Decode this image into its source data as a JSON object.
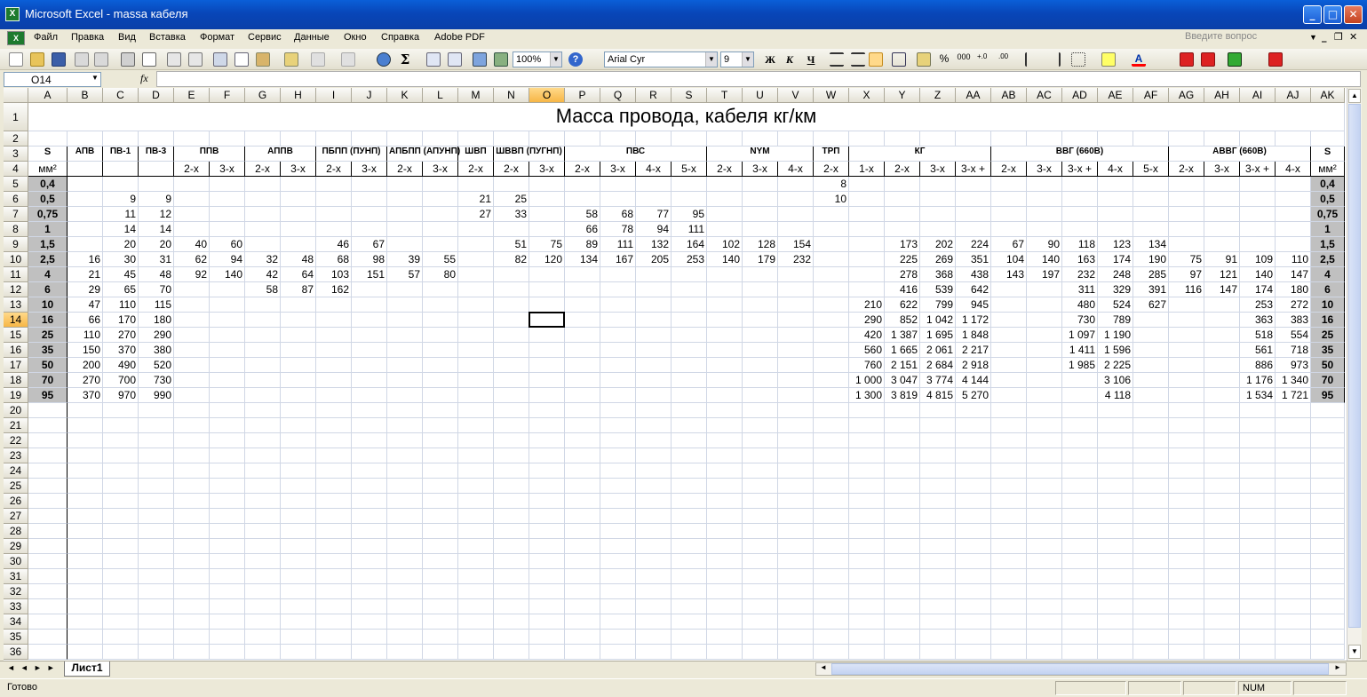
{
  "window": {
    "title": "Microsoft Excel - massa кабеля"
  },
  "menu": [
    "Файл",
    "Правка",
    "Вид",
    "Вставка",
    "Формат",
    "Сервис",
    "Данные",
    "Окно",
    "Справка",
    "Adobe PDF"
  ],
  "ask_placeholder": "Введите вопрос",
  "toolbar": {
    "zoom": "100%",
    "font": "Arial Cyr",
    "size": "9",
    "bold": "Ж",
    "italic": "К",
    "underline": "Ч",
    "percent": "%",
    "thousands": "000"
  },
  "formula": {
    "name_box": "O14",
    "fx": "fx",
    "value": ""
  },
  "columns": [
    "A",
    "B",
    "C",
    "D",
    "E",
    "F",
    "G",
    "H",
    "I",
    "J",
    "K",
    "L",
    "M",
    "N",
    "O",
    "P",
    "Q",
    "R",
    "S",
    "T",
    "U",
    "V",
    "W",
    "X",
    "Y",
    "Z",
    "AA",
    "AB",
    "AC",
    "AD",
    "AE",
    "AF",
    "AG",
    "AH",
    "AI",
    "AJ",
    "AK"
  ],
  "selected_col": "O",
  "selected_row": 14,
  "rows_count": 36,
  "sheet": {
    "title": "Масса провода, кабеля кг/км",
    "header3": [
      {
        "c": 0,
        "span": 1,
        "t": "S"
      },
      {
        "c": 1,
        "span": 1,
        "t": "АПВ"
      },
      {
        "c": 2,
        "span": 1,
        "t": "ПВ-1"
      },
      {
        "c": 3,
        "span": 1,
        "t": "ПВ-3"
      },
      {
        "c": 4,
        "span": 2,
        "t": "ППВ"
      },
      {
        "c": 6,
        "span": 2,
        "t": "АППВ"
      },
      {
        "c": 8,
        "span": 2,
        "t": "ПБПП (ПУНП)"
      },
      {
        "c": 10,
        "span": 2,
        "t": "АПБПП (АПУНП)"
      },
      {
        "c": 12,
        "span": 1,
        "t": "ШВП"
      },
      {
        "c": 13,
        "span": 2,
        "t": "ШВВП (ПУГНП)"
      },
      {
        "c": 15,
        "span": 4,
        "t": "ПВС"
      },
      {
        "c": 19,
        "span": 3,
        "t": "NYM"
      },
      {
        "c": 22,
        "span": 1,
        "t": "ТРП"
      },
      {
        "c": 23,
        "span": 4,
        "t": "КГ"
      },
      {
        "c": 27,
        "span": 5,
        "t": "ВВГ (660В)"
      },
      {
        "c": 32,
        "span": 4,
        "t": "АВВГ (660В)"
      },
      {
        "c": 36,
        "span": 1,
        "t": "S"
      }
    ],
    "header4": {
      "0": "мм²",
      "4": "2-х",
      "5": "3-х",
      "6": "2-х",
      "7": "3-х",
      "8": "2-х",
      "9": "3-х",
      "10": "2-х",
      "11": "3-х",
      "12": "2-х",
      "13": "2-х",
      "14": "3-х",
      "15": "2-х",
      "16": "3-х",
      "17": "4-х",
      "18": "5-х",
      "19": "2-х",
      "20": "3-х",
      "21": "4-х",
      "22": "2-х",
      "23": "1-х",
      "24": "2-х",
      "25": "3-х",
      "26": "3-х +",
      "27": "2-х",
      "28": "3-х",
      "29": "3-х +",
      "30": "4-х",
      "31": "5-х",
      "32": "2-х",
      "33": "3-х",
      "34": "3-х +",
      "35": "4-х",
      "36": "мм²"
    },
    "data": [
      {
        "s": "0,4",
        "v": {
          "22": "8"
        }
      },
      {
        "s": "0,5",
        "v": {
          "2": "9",
          "3": "9",
          "12": "21",
          "13": "25",
          "22": "10"
        }
      },
      {
        "s": "0,75",
        "v": {
          "2": "11",
          "3": "12",
          "12": "27",
          "13": "33",
          "15": "58",
          "16": "68",
          "17": "77",
          "18": "95"
        }
      },
      {
        "s": "1",
        "v": {
          "2": "14",
          "3": "14",
          "15": "66",
          "16": "78",
          "17": "94",
          "18": "111"
        }
      },
      {
        "s": "1,5",
        "v": {
          "2": "20",
          "3": "20",
          "4": "40",
          "5": "60",
          "8": "46",
          "9": "67",
          "13": "51",
          "14": "75",
          "15": "89",
          "16": "111",
          "17": "132",
          "18": "164",
          "19": "102",
          "20": "128",
          "21": "154",
          "24": "173",
          "25": "202",
          "26": "224",
          "27": "67",
          "28": "90",
          "29": "118",
          "30": "123",
          "31": "134"
        }
      },
      {
        "s": "2,5",
        "v": {
          "1": "16",
          "2": "30",
          "3": "31",
          "4": "62",
          "5": "94",
          "6": "32",
          "7": "48",
          "8": "68",
          "9": "98",
          "10": "39",
          "11": "55",
          "13": "82",
          "14": "120",
          "15": "134",
          "16": "167",
          "17": "205",
          "18": "253",
          "19": "140",
          "20": "179",
          "21": "232",
          "24": "225",
          "25": "269",
          "26": "351",
          "27": "104",
          "28": "140",
          "29": "163",
          "30": "174",
          "31": "190",
          "32": "75",
          "33": "91",
          "34": "109",
          "35": "110"
        }
      },
      {
        "s": "4",
        "v": {
          "1": "21",
          "2": "45",
          "3": "48",
          "4": "92",
          "5": "140",
          "6": "42",
          "7": "64",
          "8": "103",
          "9": "151",
          "10": "57",
          "11": "80",
          "24": "278",
          "25": "368",
          "26": "438",
          "27": "143",
          "28": "197",
          "29": "232",
          "30": "248",
          "31": "285",
          "32": "97",
          "33": "121",
          "34": "140",
          "35": "147"
        }
      },
      {
        "s": "6",
        "v": {
          "1": "29",
          "2": "65",
          "3": "70",
          "6": "58",
          "7": "87",
          "8": "162",
          "24": "416",
          "25": "539",
          "26": "642",
          "29": "311",
          "30": "329",
          "31": "391",
          "32": "116",
          "33": "147",
          "34": "174",
          "35": "180"
        }
      },
      {
        "s": "10",
        "v": {
          "1": "47",
          "2": "110",
          "3": "115",
          "23": "210",
          "24": "622",
          "25": "799",
          "26": "945",
          "29": "480",
          "30": "524",
          "31": "627",
          "34": "253",
          "35": "272"
        }
      },
      {
        "s": "16",
        "v": {
          "1": "66",
          "2": "170",
          "3": "180",
          "23": "290",
          "24": "852",
          "25": "1 042",
          "26": "1 172",
          "29": "730",
          "30": "789",
          "34": "363",
          "35": "383"
        }
      },
      {
        "s": "25",
        "v": {
          "1": "110",
          "2": "270",
          "3": "290",
          "23": "420",
          "24": "1 387",
          "25": "1 695",
          "26": "1 848",
          "29": "1 097",
          "30": "1 190",
          "34": "518",
          "35": "554"
        }
      },
      {
        "s": "35",
        "v": {
          "1": "150",
          "2": "370",
          "3": "380",
          "23": "560",
          "24": "1 665",
          "25": "2 061",
          "26": "2 217",
          "29": "1 411",
          "30": "1 596",
          "34": "561",
          "35": "718"
        }
      },
      {
        "s": "50",
        "v": {
          "1": "200",
          "2": "490",
          "3": "520",
          "23": "760",
          "24": "2 151",
          "25": "2 684",
          "26": "2 918",
          "29": "1 985",
          "30": "2 225",
          "34": "886",
          "35": "973"
        }
      },
      {
        "s": "70",
        "v": {
          "1": "270",
          "2": "700",
          "3": "730",
          "23": "1 000",
          "24": "3 047",
          "25": "3 774",
          "26": "4 144",
          "30": "3 106",
          "34": "1 176",
          "35": "1 340"
        }
      },
      {
        "s": "95",
        "v": {
          "1": "370",
          "2": "970",
          "3": "990",
          "23": "1 300",
          "24": "3 819",
          "25": "4 815",
          "26": "5 270",
          "30": "4 118",
          "34": "1 534",
          "35": "1 721"
        }
      }
    ]
  },
  "tabs": {
    "active": "Лист1"
  },
  "status": {
    "ready": "Готово",
    "num": "NUM"
  },
  "colors": {
    "header_gray": "#c0c0c0",
    "selection": "#f7b646"
  }
}
